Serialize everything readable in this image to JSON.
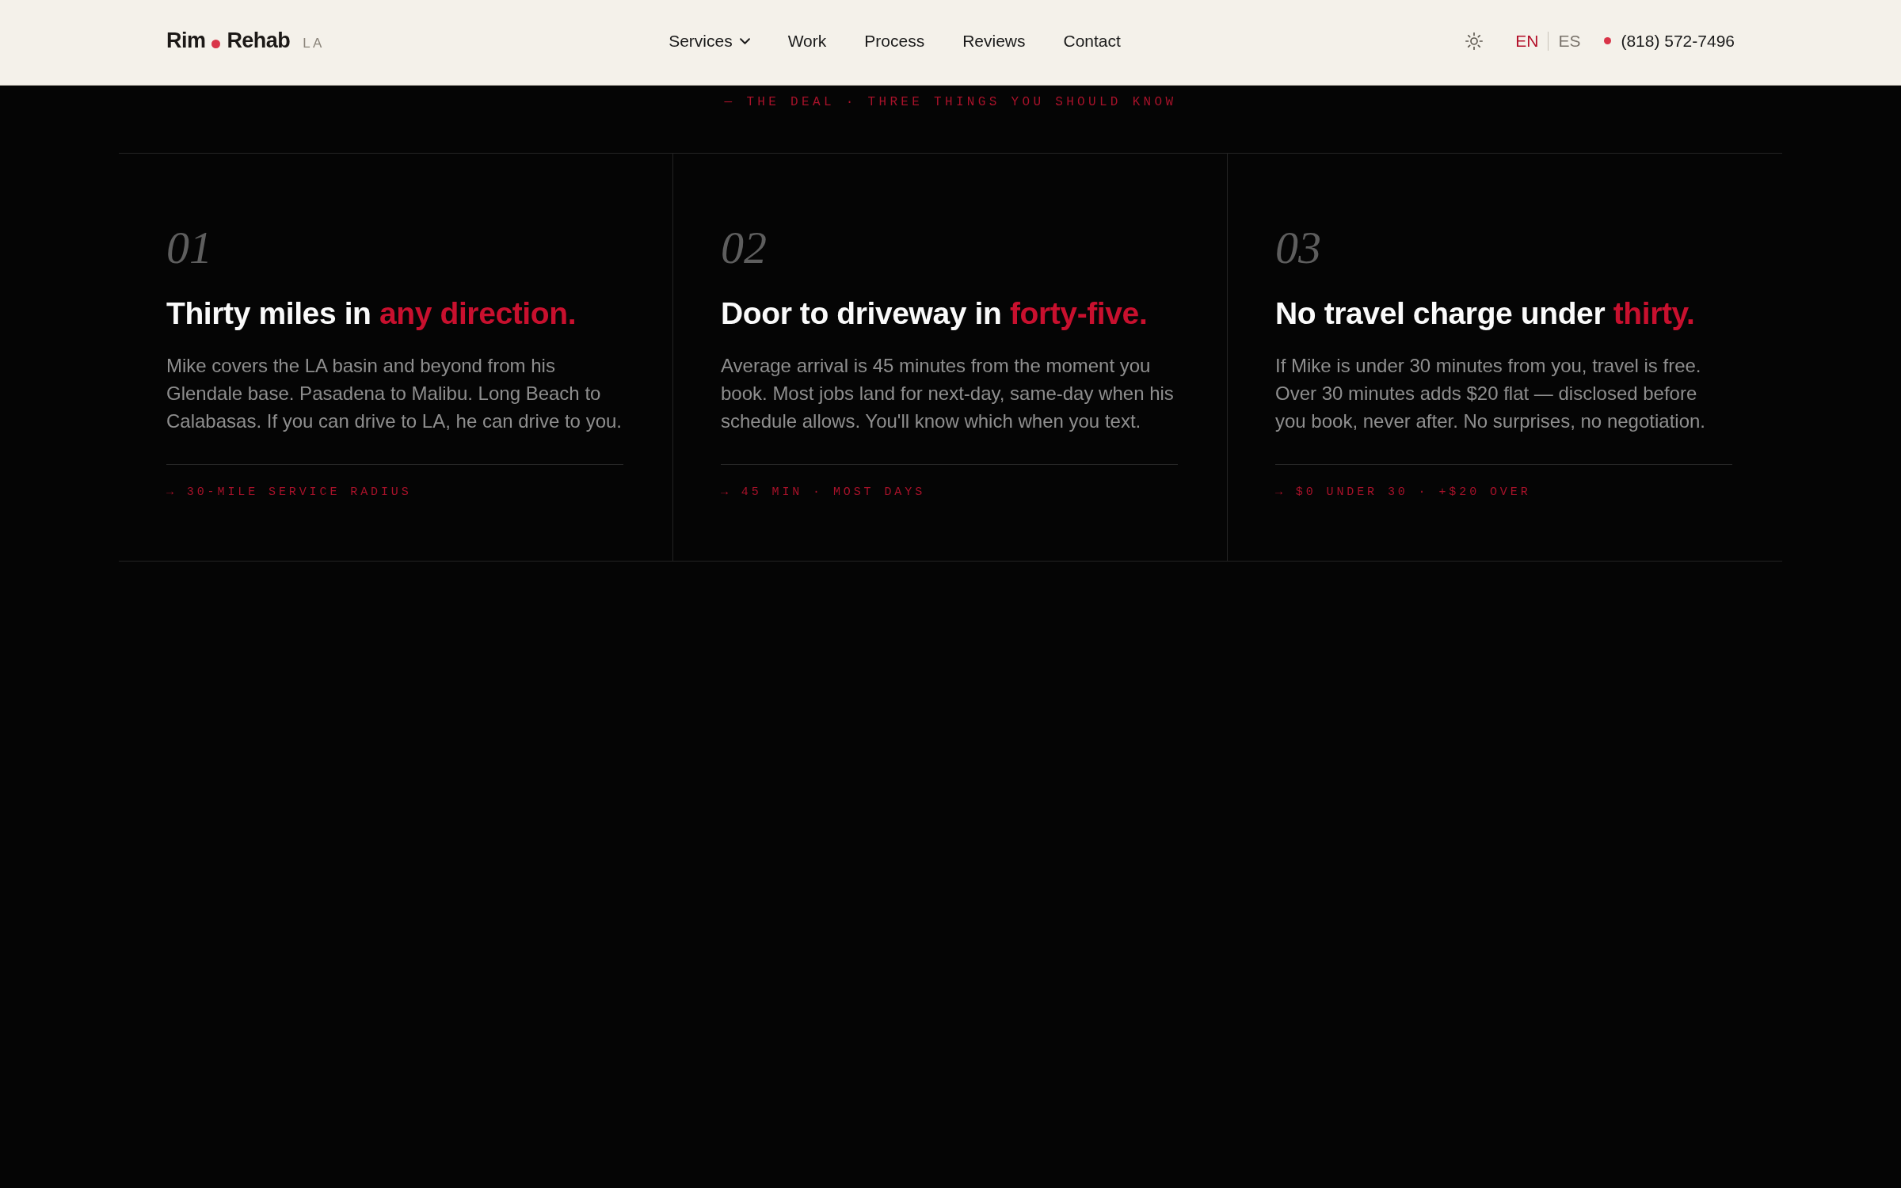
{
  "header": {
    "logo": {
      "first": "Rim",
      "second": "Rehab",
      "suffix": "LA"
    },
    "nav": [
      {
        "label": "Services",
        "has_menu": true
      },
      {
        "label": "Work",
        "has_menu": false
      },
      {
        "label": "Process",
        "has_menu": false
      },
      {
        "label": "Reviews",
        "has_menu": false
      },
      {
        "label": "Contact",
        "has_menu": false
      }
    ],
    "languages": [
      {
        "label": "EN",
        "selected": true
      },
      {
        "label": "ES",
        "selected": false
      }
    ],
    "phone": "(818) 572-7496"
  },
  "section": {
    "eyebrow": "— THE DEAL · THREE THINGS YOU SHOULD KNOW",
    "cards": [
      {
        "number": "01",
        "title": "Thirty miles in",
        "title_accent": "any direction.",
        "body": "Mike covers the LA basin and beyond from his Glendale base. Pasadena to Malibu. Long Beach to Calabasas. If you can drive to LA, he can drive to you.",
        "tagline": "→ 30-MILE SERVICE RADIUS"
      },
      {
        "number": "02",
        "title": "Door to driveway in",
        "title_accent": "forty-five.",
        "body": "Average arrival is 45 minutes from the moment you book. Most jobs land for next-day, same-day when his schedule allows. You'll know which when you text.",
        "tagline": "→ 45 MIN · MOST DAYS"
      },
      {
        "number": "03",
        "title": "No travel charge under",
        "title_accent": "thirty.",
        "body": "If Mike is under 30 minutes from you, travel is free. Over 30 minutes adds $20 flat — disclosed before you book, never after. No surprises, no negotiation.",
        "tagline": "→ $0 UNDER 30 · +$20 OVER"
      }
    ]
  }
}
